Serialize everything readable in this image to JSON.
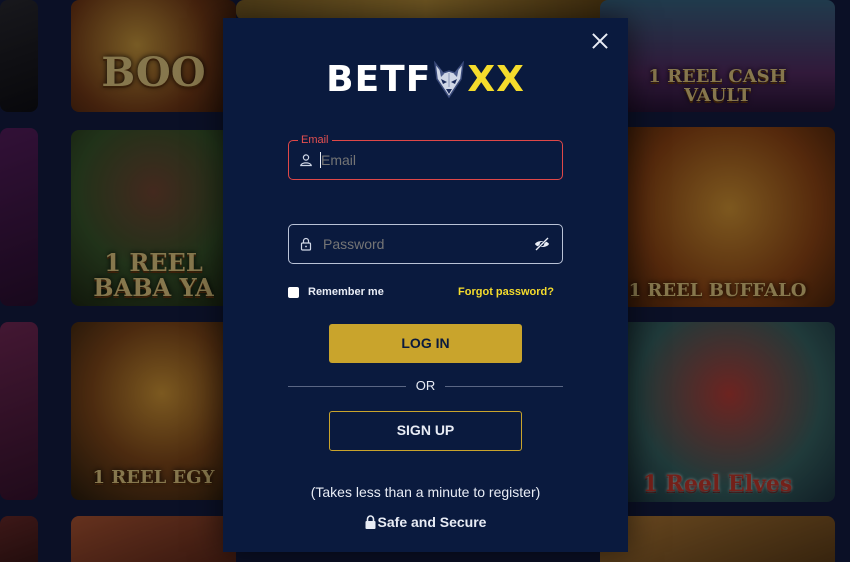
{
  "background": {
    "tiles": [
      {
        "label": "BOO"
      },
      {
        "label": "1 REEL BABA YA"
      },
      {
        "label": "1 REEL EGY"
      },
      {
        "label": "1 REEL CASH VAULT"
      },
      {
        "label": "1 REEL BUFFALO"
      },
      {
        "label": "1 Reel Elves"
      }
    ]
  },
  "modal": {
    "logo": {
      "part1": "BETF",
      "part2": "XX",
      "icon": "fox-head-icon"
    },
    "close_icon": "close-icon",
    "email": {
      "legend": "Email",
      "placeholder": "Email",
      "value": "",
      "icon": "user-icon"
    },
    "password": {
      "placeholder": "Password",
      "value": "",
      "icon": "lock-icon",
      "toggle_icon": "eye-off-icon"
    },
    "remember_label": "Remember me",
    "forgot_label": "Forgot password?",
    "login_label": "LOG IN",
    "or_label": "OR",
    "signup_label": "SIGN UP",
    "hint": "(Takes less than a minute to register)",
    "secure_label": "Safe and Secure"
  },
  "colors": {
    "modal_bg": "#0a1a3e",
    "accent_yellow": "#f5dc2c",
    "button_gold": "#c9a42c",
    "error_red": "#e04848"
  }
}
